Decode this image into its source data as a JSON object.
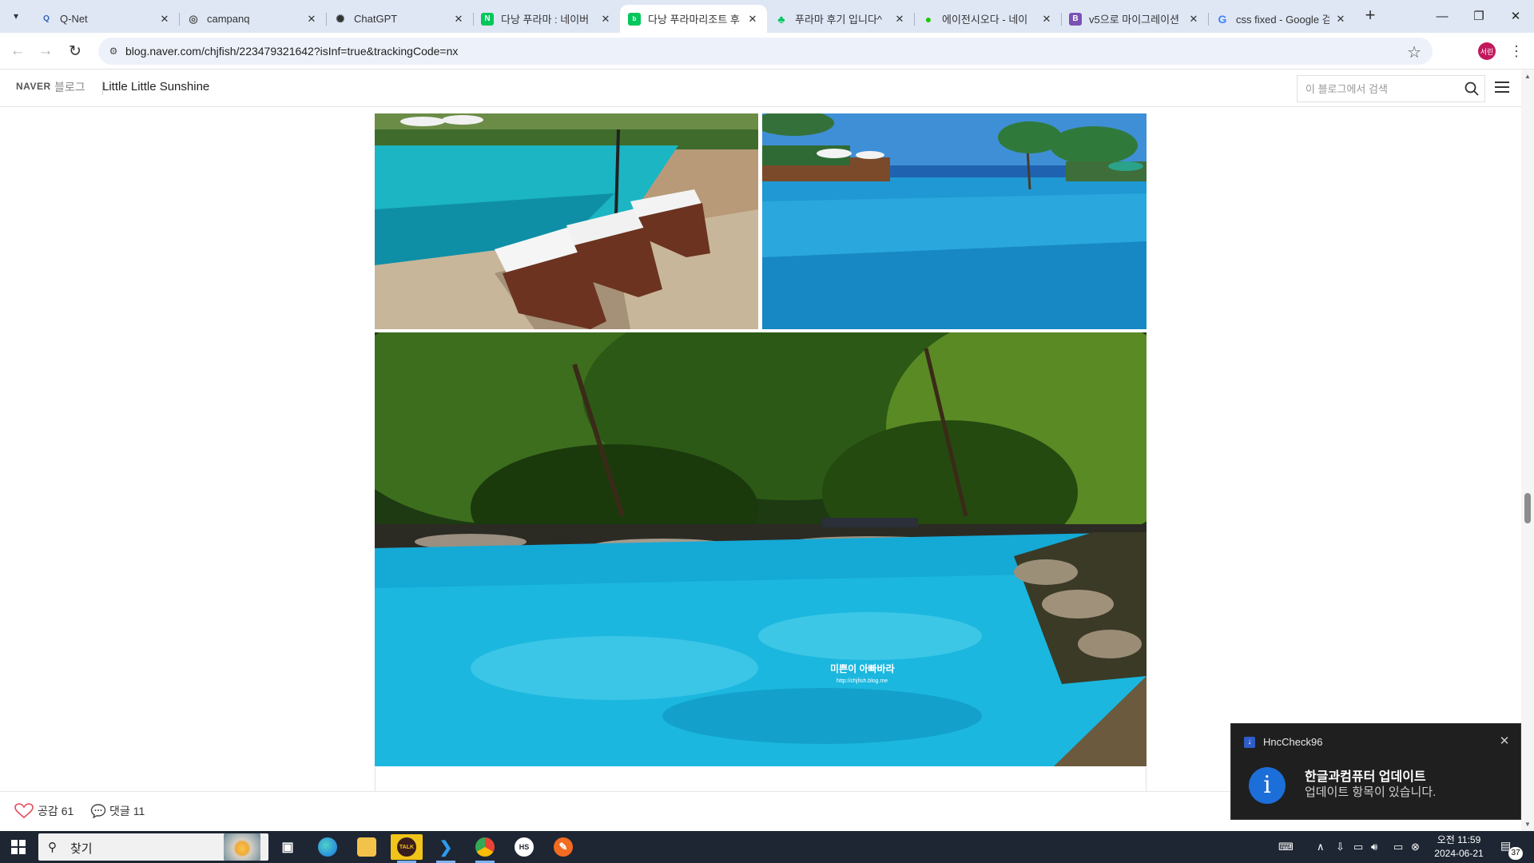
{
  "browser": {
    "tabs": [
      {
        "title": "Q-Net",
        "favicon": "qnet-icon",
        "favicon_color": "#2b5fb8",
        "active": false
      },
      {
        "title": "campanq",
        "favicon": "globe-icon",
        "favicon_color": "#555555",
        "active": false
      },
      {
        "title": "ChatGPT",
        "favicon": "chatgpt-icon",
        "favicon_color": "#333333",
        "active": false
      },
      {
        "title": "다낭 푸라마 : 네이버",
        "favicon": "naver-n-icon",
        "favicon_color": "#03c75a",
        "active": false
      },
      {
        "title": "다낭 푸라마리조트 후",
        "favicon": "naver-blog-icon",
        "favicon_color": "#03c75a",
        "active": true
      },
      {
        "title": "푸라마 후기 입니다^",
        "favicon": "naver-leaf-icon",
        "favicon_color": "#03c75a",
        "active": false
      },
      {
        "title": "에이전시오다 - 네이",
        "favicon": "naver-green-icon",
        "favicon_color": "#1ec800",
        "active": false
      },
      {
        "title": "v5으로 마이그레이션",
        "favicon": "bootstrap-icon",
        "favicon_color": "#7952b3",
        "active": false
      },
      {
        "title": "css fixed - Google 검",
        "favicon": "google-icon",
        "favicon_color": "#4285f4",
        "active": false
      }
    ],
    "url": "blog.naver.com/chjfish/223479321642?isInf=true&trackingCode=nx",
    "profile_initials": "서린"
  },
  "blog": {
    "brand": "NAVER",
    "brand_sub": "블로그",
    "title": "Little Little Sunshine",
    "search_placeholder": "이 블로그에서 검색"
  },
  "post": {
    "photo_watermark_line1": "미쁜이 아빠바라",
    "photo_watermark_line2": "http://chjfish.blog.me"
  },
  "reactions": {
    "like_label": "공감",
    "like_count": "61",
    "comment_label": "댓글",
    "comment_count": "11"
  },
  "taskbar": {
    "search_label": "찾기",
    "clock_time": "오전 11:59",
    "clock_date": "2024-06-21",
    "notification_count": "37"
  },
  "toast": {
    "app_name": "HncCheck96",
    "title": "한글과컴퓨터 업데이트",
    "body": "업데이트 항목이 있습니다."
  }
}
